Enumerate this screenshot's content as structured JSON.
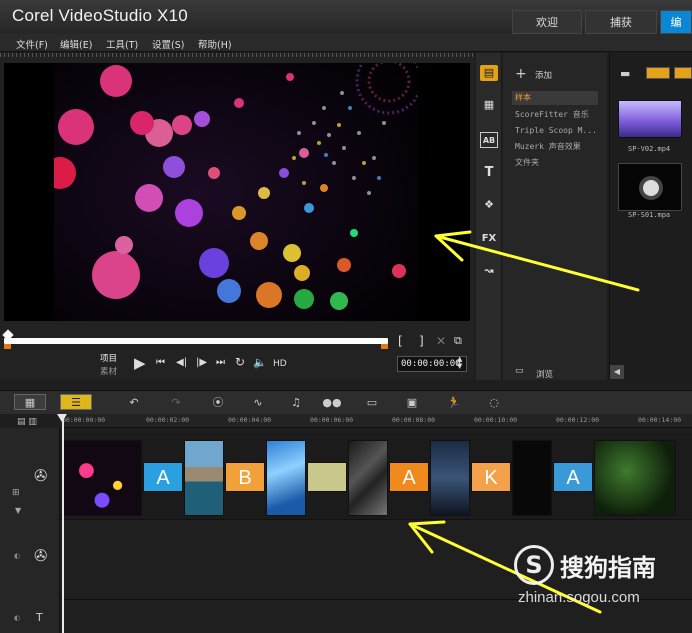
{
  "app": {
    "title": "Corel VideoStudio X10"
  },
  "tabs": [
    {
      "label": "欢迎"
    },
    {
      "label": "捕获"
    },
    {
      "label": "编"
    }
  ],
  "menu": [
    "文件(F)",
    "编辑(E)",
    "工具(T)",
    "设置(S)",
    "帮助(H)"
  ],
  "player": {
    "mode_project": "项目",
    "mode_clip": "素材",
    "hd_label": "HD",
    "timecode": "00:00:00:00",
    "scrub_position": 0.0
  },
  "library": {
    "add_label": "添加",
    "folders": [
      "样本",
      "ScoreFitter 音乐",
      "Triple Scoop M...",
      "Muzerk 声音效果",
      "文件夹"
    ],
    "browse_label": "浏览",
    "items": [
      {
        "caption": "SP-V02.mp4"
      },
      {
        "caption": "SP-S01.mpa"
      }
    ]
  },
  "timeline": {
    "ruler_labels": [
      "00:00:00:00",
      "00:00:02:00",
      "00:00:04:00",
      "00:00:06:00",
      "00:00:08:00",
      "00:00:10:00",
      "00:00:12:00",
      "00:00:14:00"
    ],
    "transitions": [
      "A",
      "B",
      "",
      "A",
      "K",
      "A"
    ]
  },
  "watermark": {
    "logo": "S",
    "text": "搜狗指南",
    "url": "zhinan.sogou.com"
  },
  "colors": {
    "accent_blue": "#0a86d4",
    "marker_orange": "#e07a14",
    "arrow_yellow": "#ffff33"
  }
}
